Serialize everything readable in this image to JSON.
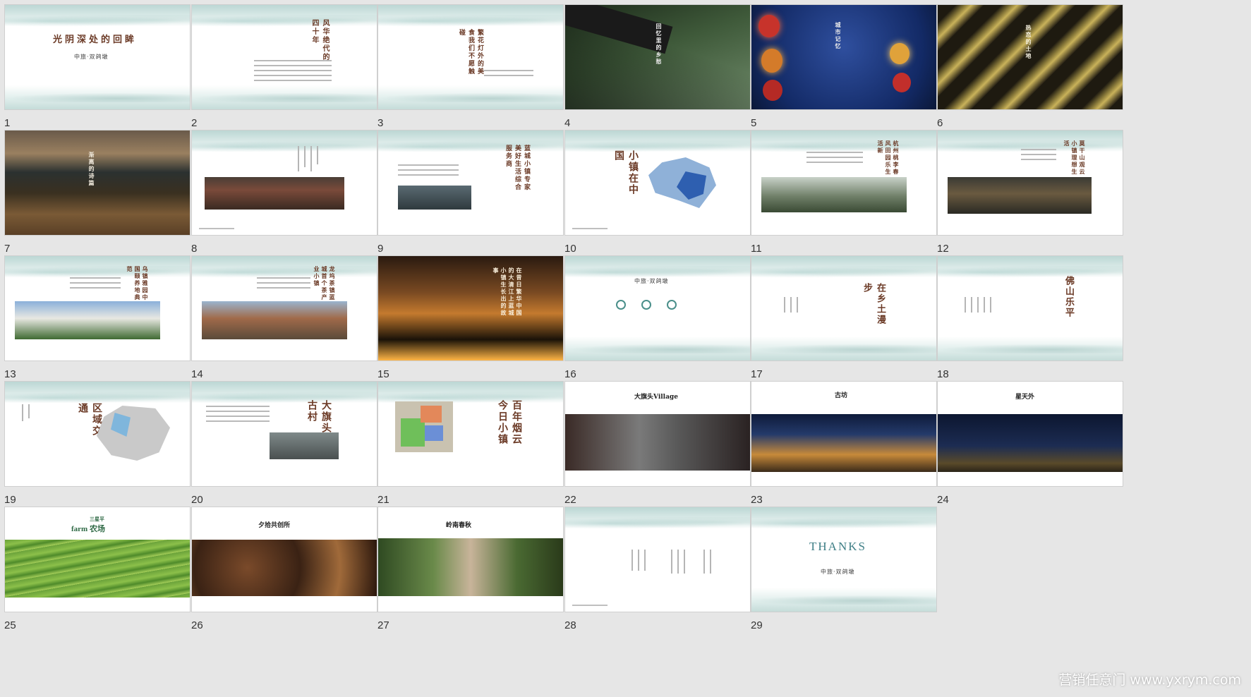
{
  "slides": [
    {
      "n": "1",
      "title": "光阴深处的回眸",
      "logo": "中旅·双鸽墩"
    },
    {
      "n": "2",
      "title": "风华绝代的四十年"
    },
    {
      "n": "3",
      "title": "繁花灯外的美食我们不愿触碰"
    },
    {
      "n": "4",
      "title": "回忆里的乡愁"
    },
    {
      "n": "5",
      "title": "城市记忆"
    },
    {
      "n": "6",
      "title": "热恋的土地"
    },
    {
      "n": "7",
      "title": "渐离的诗篇"
    },
    {
      "n": "8",
      "title": ""
    },
    {
      "n": "9",
      "title": "蓝城小镇专家美好生活综合服务商"
    },
    {
      "n": "10",
      "title": "小镇在中国"
    },
    {
      "n": "11",
      "title": "杭州桃李春风田园乐生活新"
    },
    {
      "n": "12",
      "title": "莫干山观云小镇理想生活"
    },
    {
      "n": "13",
      "title": "乌镇雅园中国颐养地典范"
    },
    {
      "n": "14",
      "title": "龙坞茶镇蓝城首个茶产业小镇"
    },
    {
      "n": "15",
      "title": "在昔日繁华中国的大清江上蓝城小镇生长出的故事"
    },
    {
      "n": "16",
      "title": "",
      "logo": "中旅·双鸽墩"
    },
    {
      "n": "17",
      "title": "在乡土漫步"
    },
    {
      "n": "18",
      "title": "佛山乐平"
    },
    {
      "n": "19",
      "title": "区域交通"
    },
    {
      "n": "20",
      "title": "大旗头古村"
    },
    {
      "n": "21",
      "title": "百年烟云今日小镇"
    },
    {
      "n": "22",
      "title": "大旗头Village"
    },
    {
      "n": "23",
      "title": "古坊"
    },
    {
      "n": "24",
      "title": "星天外"
    },
    {
      "n": "25",
      "title": "farm 农场",
      "subtitle": "三星平"
    },
    {
      "n": "26",
      "title": "夕拾共创所"
    },
    {
      "n": "27",
      "title": "岭南春秋"
    },
    {
      "n": "28",
      "title": ""
    },
    {
      "n": "29",
      "title": "THANKS",
      "logo": "中旅·双鸽墩"
    }
  ],
  "watermark": "营销任意门 www.yxrym.com"
}
